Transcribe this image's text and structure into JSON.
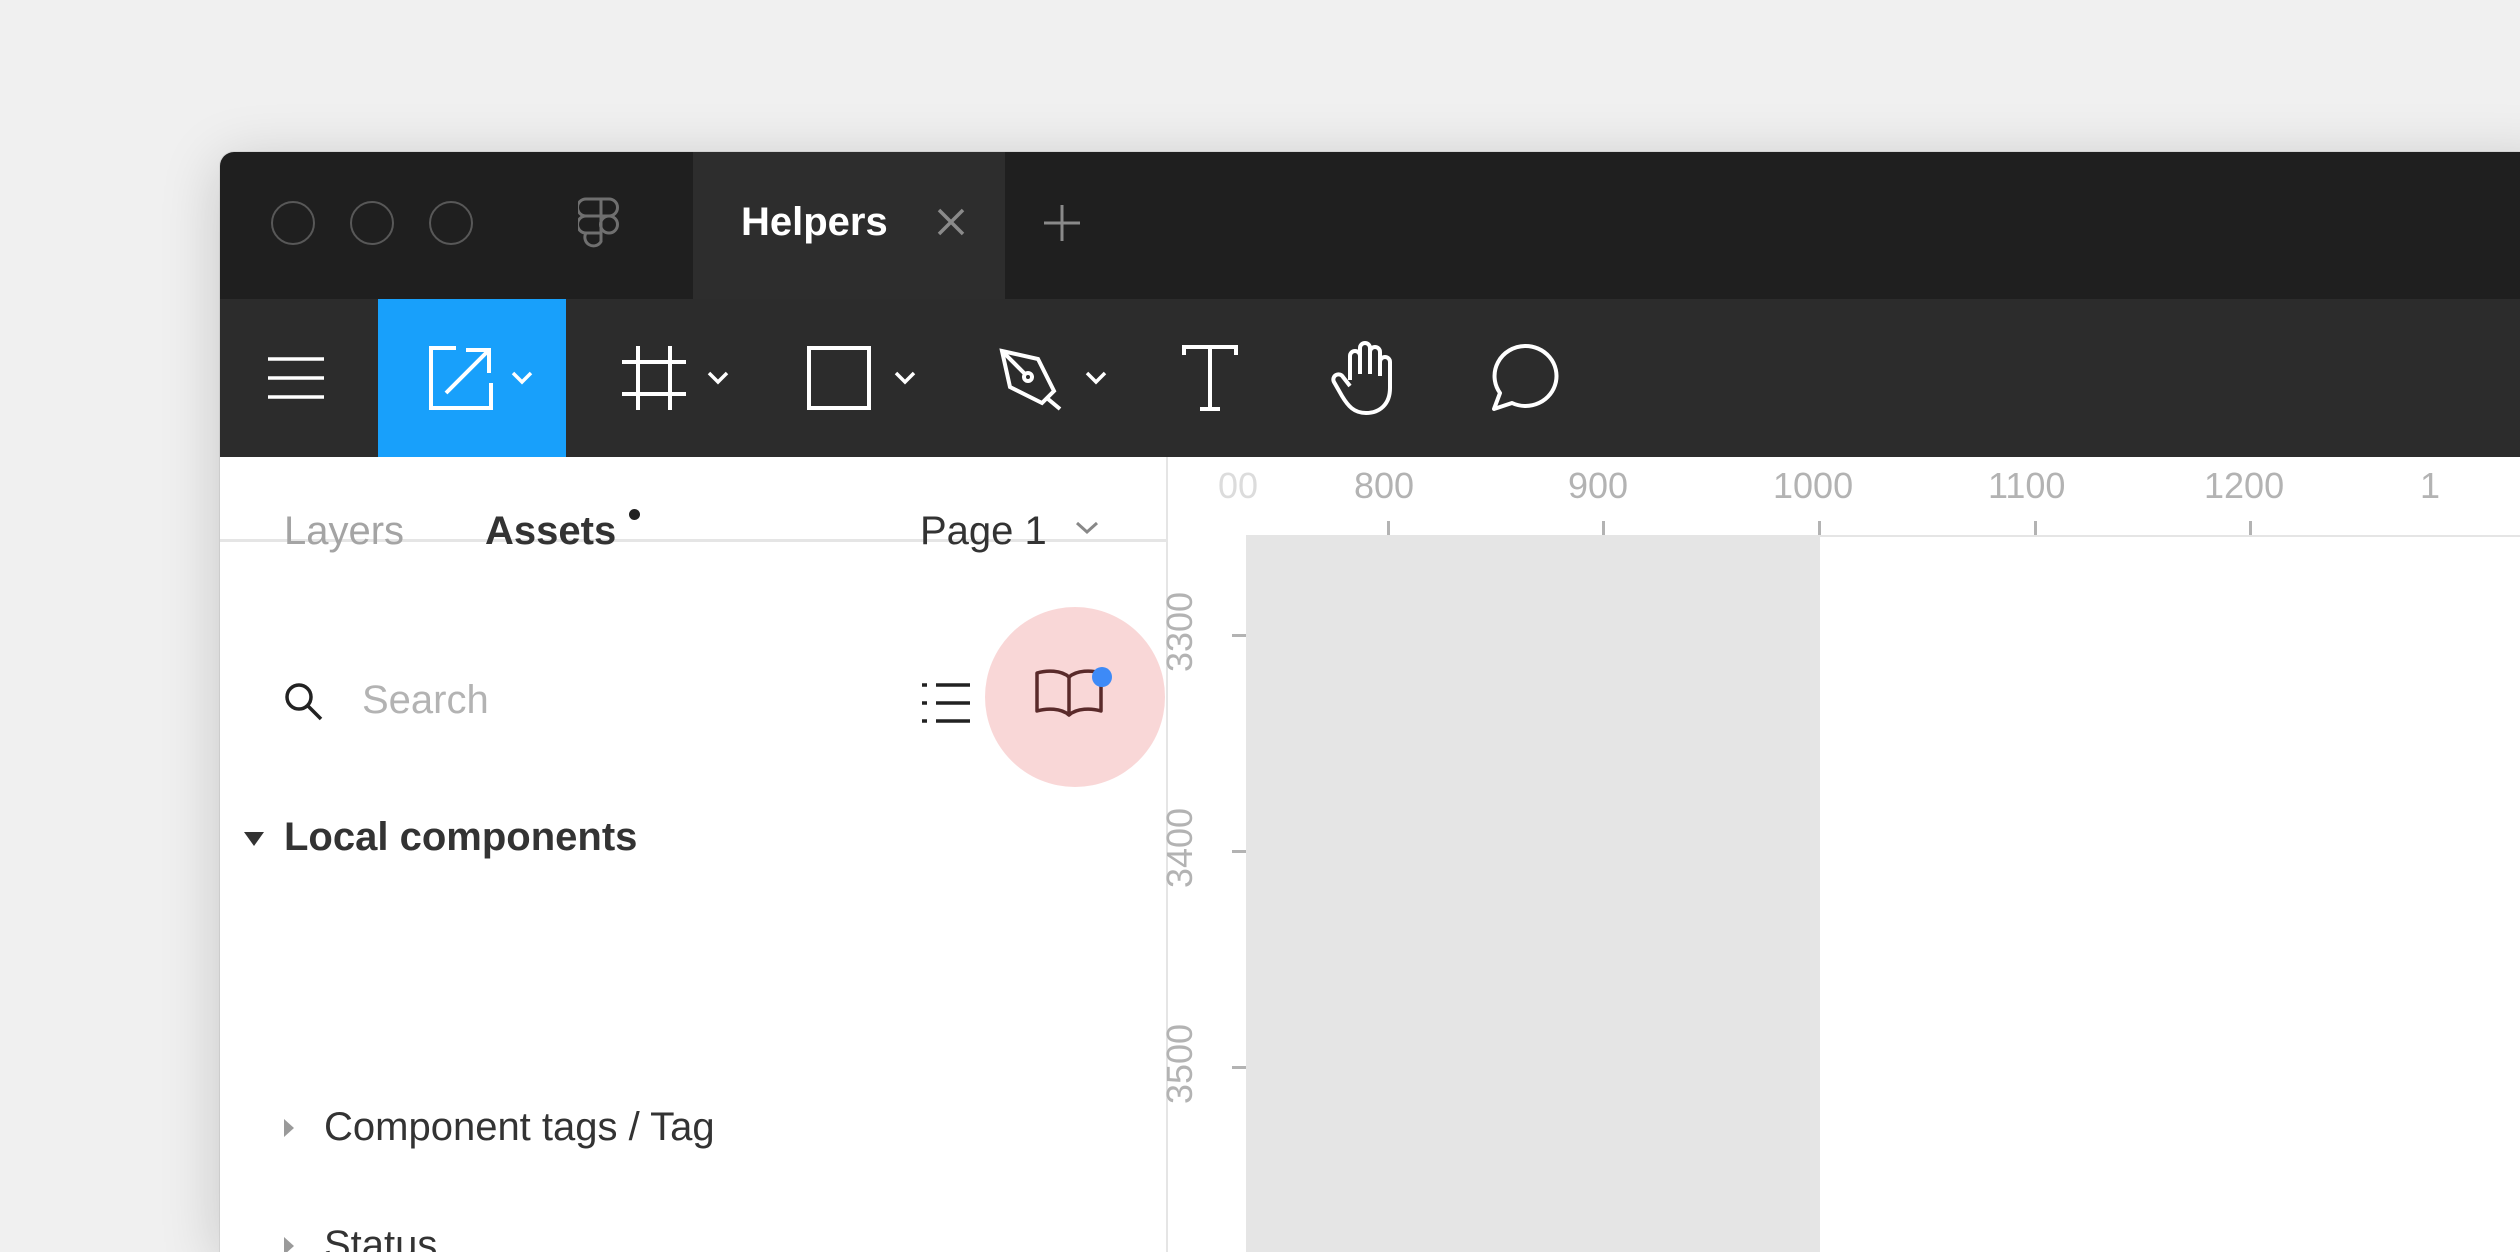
{
  "window": {
    "active_tab": "Helpers"
  },
  "panel": {
    "tabs": [
      {
        "label": "Layers"
      },
      {
        "label": "Assets"
      }
    ],
    "page": "Page 1",
    "search": {
      "placeholder": "Search"
    },
    "section": {
      "title": "Local components"
    },
    "items": [
      {
        "label": "Component tags / Tag"
      },
      {
        "label": "Status"
      }
    ]
  },
  "rulers": {
    "top": [
      "00",
      "800",
      "900",
      "1000",
      "1100",
      "1200",
      "1"
    ],
    "left": [
      "3300",
      "3400",
      "3500"
    ]
  },
  "colors": {
    "accent": "#18a0fb",
    "notification": "#3d8af7",
    "highlight": "#f5c9c9"
  },
  "icons": [
    "figma-logo-icon",
    "close-icon",
    "plus-icon",
    "menu-icon",
    "move-icon",
    "frame-icon",
    "rectangle-icon",
    "pen-icon",
    "text-icon",
    "hand-icon",
    "comment-icon",
    "search-icon",
    "list-view-icon",
    "library-icon",
    "caret-down-icon",
    "caret-right-icon",
    "chevron-down-icon"
  ]
}
